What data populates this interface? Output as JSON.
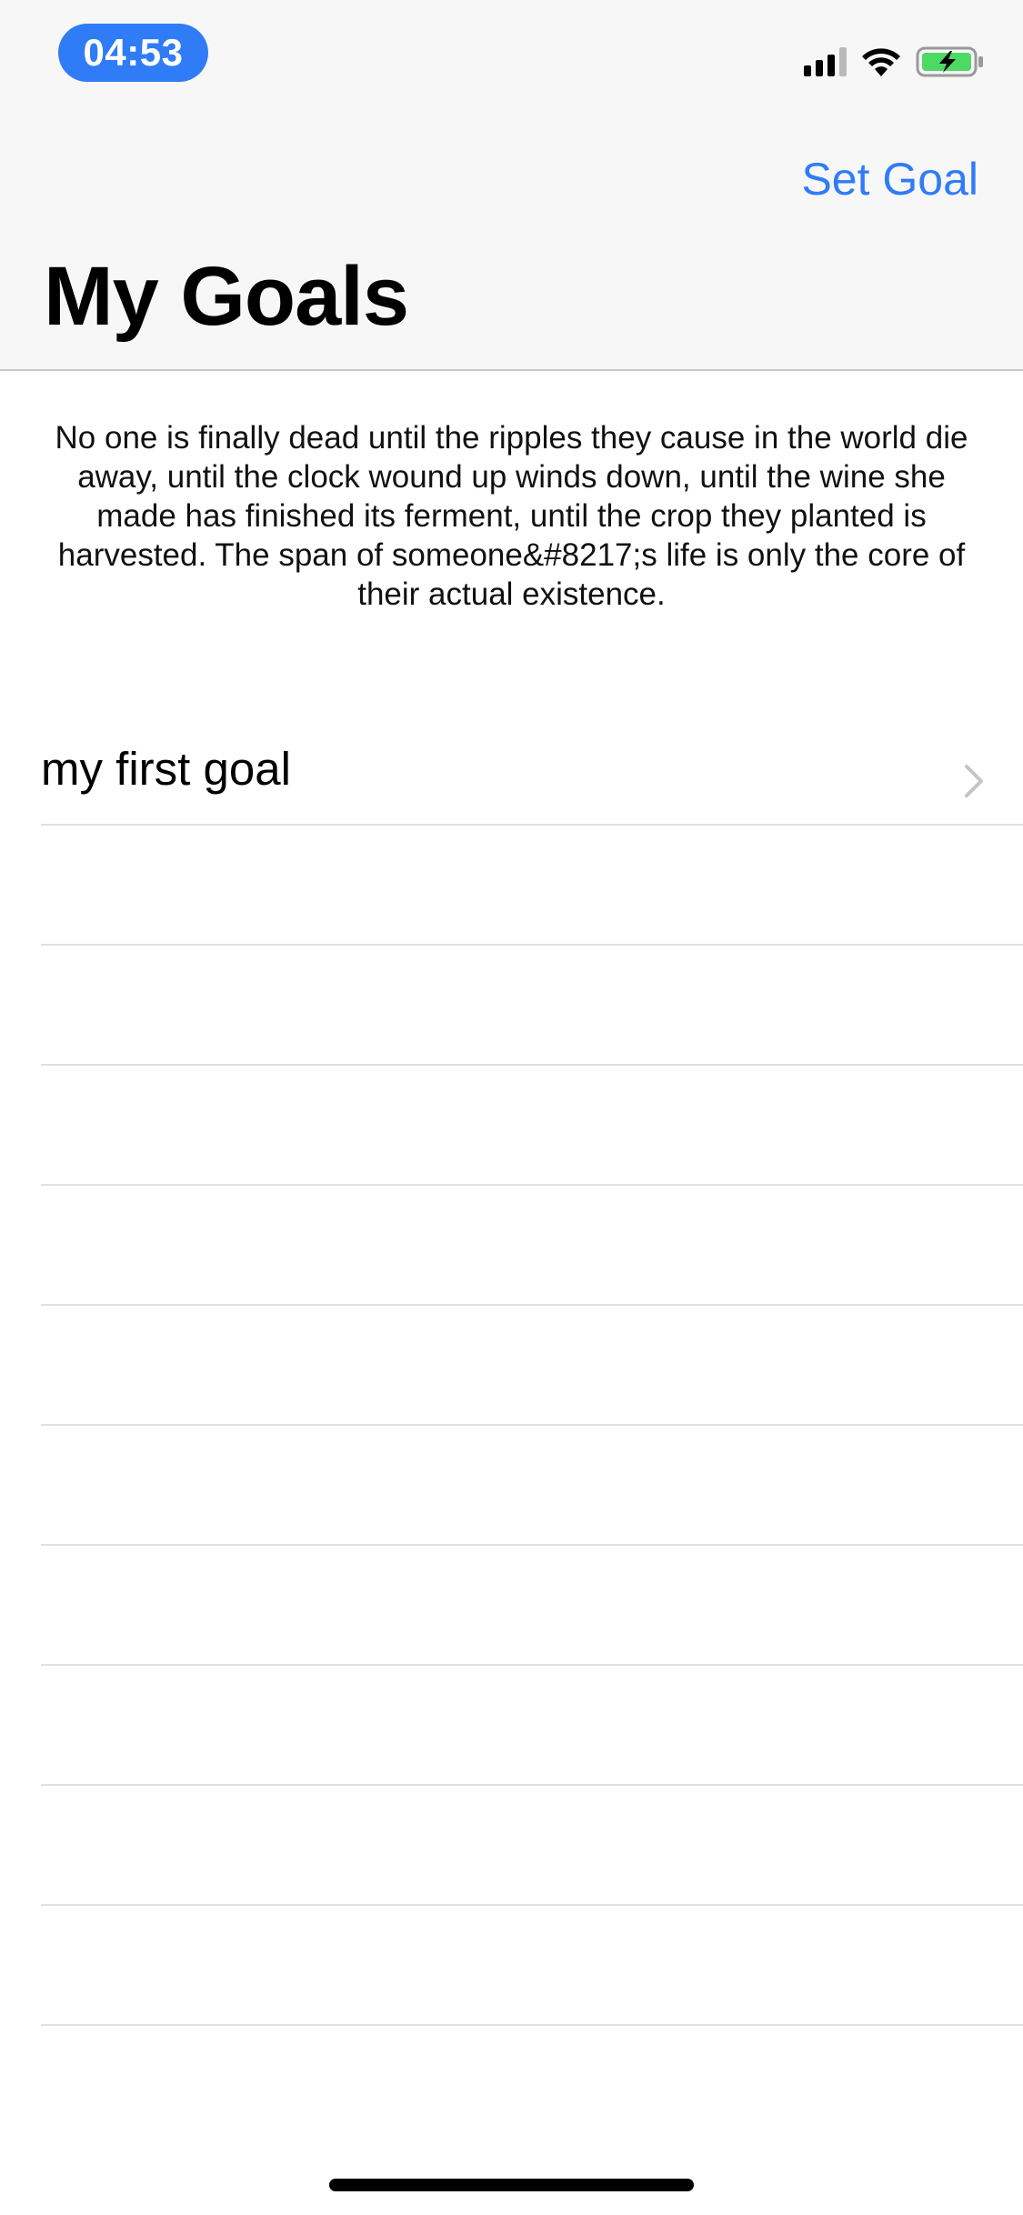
{
  "status_bar": {
    "time": "04:53",
    "signal_icon": "cellular-signal-icon",
    "wifi_icon": "wifi-icon",
    "battery_icon": "battery-charging-icon"
  },
  "nav": {
    "set_goal_label": "Set Goal",
    "title": "My Goals"
  },
  "quote": {
    "text": "No one is finally dead until the ripples they cause in the world die away, until the clock wound up winds down, until the wine she made has finished its ferment, until the crop they planted is harvested. The span of someone&#8217;s life is only the core of their actual existence."
  },
  "goals": [
    {
      "title": "my first goal",
      "icon": "chevron-right-icon"
    },
    {
      "title": ""
    },
    {
      "title": ""
    },
    {
      "title": ""
    },
    {
      "title": ""
    },
    {
      "title": ""
    },
    {
      "title": ""
    },
    {
      "title": ""
    },
    {
      "title": ""
    },
    {
      "title": ""
    },
    {
      "title": ""
    }
  ],
  "colors": {
    "accent": "#2f7cf6",
    "battery_fill": "#4cd964",
    "nav_background": "#f7f7f7",
    "separator": "#e0e0e3"
  }
}
